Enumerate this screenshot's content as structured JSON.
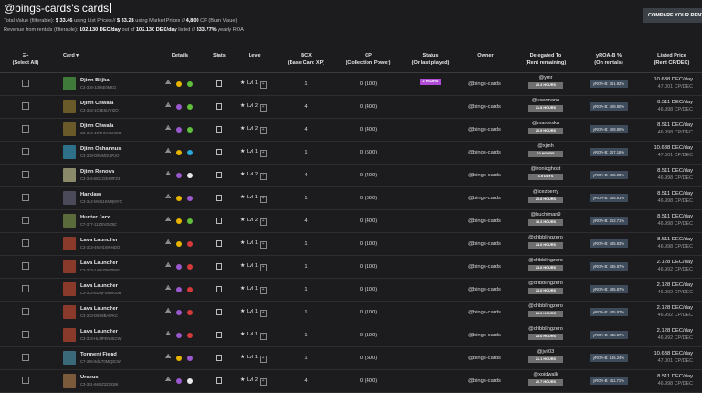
{
  "title": "@bings-cards's cards",
  "summary": {
    "line1_a": "Total Value (filterable):",
    "list_value": "$ 33.46",
    "line1_b": "using List Prices //",
    "market_value": "$ 33.28",
    "line1_c": "using Market Prices //",
    "burn_value": "4,800",
    "line1_d": "CP (Burn Value)",
    "line2_a": "Revenue from rentals (filterable):",
    "revenue": "102.130 DEC/day",
    "line2_b": "out of",
    "revenue_total": "102.130 DEC/day",
    "line2_c": "listed //",
    "yearly_roa": "333.77%",
    "line2_d": "yearly ROA"
  },
  "compare_button": "COMPARE YOUR RENTAL",
  "headers": {
    "select_all": "Ξ+",
    "select_all_sub": "(Select All)",
    "card": "Card ▾",
    "details": "Details",
    "stats": "Stats",
    "level": "Level",
    "bcx": "BCX",
    "bcx_sub": "(Base Card XP)",
    "cp": "CP",
    "cp_sub": "(Collection Power)",
    "status": "Status",
    "status_sub": "(Or last played)",
    "owner": "Owner",
    "delegated": "Delegated To",
    "delegated_sub": "(Rent remaining)",
    "yroa": "yROA-B %",
    "yroa_sub": "(On rentals)",
    "listed": "Listed Price",
    "listed_sub": "(Rent CP/DEC)"
  },
  "colors": {
    "status_purple": "#b04bd6",
    "rent_gray": "#6f6f6f",
    "roa_blue": "#3e4b5a"
  },
  "rows": [
    {
      "name": "Djinn Biljka",
      "id": "C3-336-3J9SE0MKG",
      "level": "Lvl 1",
      "bcx": "1",
      "cp": "0 (100)",
      "status": "2 HOURS",
      "owner": "@bings-cards",
      "deleg_user": "@ymr",
      "deleg_rent": "20.3 HOURS",
      "yroa": "yROA-B: 361.92%",
      "price1": "10.638 DEC/day",
      "price2": "47.001 CP/DEC",
      "thumb": "#3f7a3a",
      "d1": "#e6b400",
      "d2": "#5fbf3a"
    },
    {
      "name": "Djinn Chwala",
      "id": "C3-348-1C9E6UYJZO",
      "level": "Lvl 2",
      "bcx": "4",
      "cp": "0 (400)",
      "status": "",
      "owner": "@bings-cards",
      "deleg_user": "@usermano",
      "deleg_rent": "21.8 HOURS",
      "yroa": "yROA-B: 408.80%",
      "price1": "8.511 DEC/day",
      "price2": "46.998 CP/DEC",
      "thumb": "#6a5a2a",
      "d1": "#9b59d0",
      "d2": "#5fbf3a"
    },
    {
      "name": "Djinn Chwala",
      "id": "C3-348-1STHXHMKGO",
      "level": "Lvl 2",
      "bcx": "4",
      "cp": "0 (400)",
      "status": "",
      "owner": "@bings-cards",
      "deleg_user": "@marceska",
      "deleg_rent": "20.9 HOURS",
      "yroa": "yROA-B: 408.80%",
      "price1": "8.511 DEC/day",
      "price2": "46.998 CP/DEC",
      "thumb": "#6a5a2a",
      "d1": "#9b59d0",
      "d2": "#5fbf3a"
    },
    {
      "name": "Djinn Oshannus",
      "id": "C3-339-D9UMGUPUO",
      "level": "Lvl 1",
      "bcx": "1",
      "cp": "0 (500)",
      "status": "",
      "owner": "@bings-cards",
      "deleg_user": "@xjmh",
      "deleg_rent": "22 HOURS",
      "yroa": "yROA-B: 267.16%",
      "price1": "10.638 DEC/day",
      "price2": "47.001 CP/DEC",
      "thumb": "#2e6f8a",
      "d1": "#e6b400",
      "d2": "#2aa8d8"
    },
    {
      "name": "Djinn Renova",
      "id": "C3-345-BGZO3HMFZ4",
      "level": "Lvl 2",
      "bcx": "4",
      "cp": "0 (400)",
      "status": "",
      "owner": "@bings-cards",
      "deleg_user": "@ironicghost",
      "deleg_rent": "1.5 DAYS",
      "yroa": "yROA-B: 465.93%",
      "price1": "8.511 DEC/day",
      "price2": "46.998 CP/DEC",
      "thumb": "#8a8a6a",
      "d1": "#9b59d0",
      "d2": "#e8e8e8"
    },
    {
      "name": "Harklaw",
      "id": "C3-342-MVN1KMQMYO",
      "level": "Lvl 1",
      "bcx": "1",
      "cp": "0 (500)",
      "status": "",
      "owner": "@bings-cards",
      "deleg_user": "@icezberry",
      "deleg_rent": "20.8 HOURS",
      "yroa": "yROA-B: 365.61%",
      "price1": "8.511 DEC/day",
      "price2": "46.998 CP/DEC",
      "thumb": "#4a4a5a",
      "d1": "#e6b400",
      "d2": "#9b59d0"
    },
    {
      "name": "Hunter Jarx",
      "id": "C7-377-11Z8IVDG9C",
      "level": "Lvl 2",
      "bcx": "4",
      "cp": "0 (400)",
      "status": "",
      "owner": "@bings-cards",
      "deleg_user": "@huchiman9",
      "deleg_rent": "18.3 HOURS",
      "yroa": "yROA-B: 252.71%",
      "price1": "8.511 DEC/day",
      "price2": "46.998 CP/DEC",
      "thumb": "#5a6a3a",
      "d1": "#e6b400",
      "d2": "#5fbf3a"
    },
    {
      "name": "Lava Launcher",
      "id": "C3-333-4NIH1WHNDO",
      "level": "Lvl 1",
      "bcx": "1",
      "cp": "0 (100)",
      "status": "",
      "owner": "@bings-cards",
      "deleg_user": "@dribblingzero",
      "deleg_rent": "23.6 HOURS",
      "yroa": "yROA-B: 445.83%",
      "price1": "8.511 DEC/day",
      "price2": "46.998 CP/DEC",
      "thumb": "#8a3a2a",
      "d1": "#e6b400",
      "d2": "#d43a3a"
    },
    {
      "name": "Lava Launcher",
      "id": "C3-333-1A6U7WZE9G",
      "level": "Lvl 1",
      "bcx": "1",
      "cp": "0 (100)",
      "status": "",
      "owner": "@bings-cards",
      "deleg_user": "@dribblingzero",
      "deleg_rent": "23.6 HOURS",
      "yroa": "yROA-B: 445.87%",
      "price1": "2.128 DEC/day",
      "price2": "46.992 CP/DEC",
      "thumb": "#8a3a2a",
      "d1": "#9b59d0",
      "d2": "#d43a3a"
    },
    {
      "name": "Lava Launcher",
      "id": "C3-333-EDQFSMOG08",
      "level": "Lvl 1",
      "bcx": "1",
      "cp": "0 (100)",
      "status": "",
      "owner": "@bings-cards",
      "deleg_user": "@dribblingzero",
      "deleg_rent": "23.6 HOURS",
      "yroa": "yROA-B: 445.87%",
      "price1": "2.128 DEC/day",
      "price2": "46.992 CP/DEC",
      "thumb": "#8a3a2a",
      "d1": "#9b59d0",
      "d2": "#d43a3a"
    },
    {
      "name": "Lava Launcher",
      "id": "C3-333-D6S8BAIPKC",
      "level": "Lvl 1",
      "bcx": "1",
      "cp": "0 (100)",
      "status": "",
      "owner": "@bings-cards",
      "deleg_user": "@dribblingzero",
      "deleg_rent": "23.6 HOURS",
      "yroa": "yROA-B: 445.87%",
      "price1": "2.128 DEC/day",
      "price2": "46.992 CP/DEC",
      "thumb": "#8a3a2a",
      "d1": "#9b59d0",
      "d2": "#d43a3a"
    },
    {
      "name": "Lava Launcher",
      "id": "C3-333-HLMFEN4SCW",
      "level": "Lvl 1",
      "bcx": "1",
      "cp": "0 (100)",
      "status": "",
      "owner": "@bings-cards",
      "deleg_user": "@dribblingzero",
      "deleg_rent": "23.6 HOURS",
      "yroa": "yROA-B: 445.87%",
      "price1": "2.128 DEC/day",
      "price2": "46.992 CP/DEC",
      "thumb": "#8a3a2a",
      "d1": "#9b59d0",
      "d2": "#d43a3a"
    },
    {
      "name": "Torment Fiend",
      "id": "C7-356-9dUT0MQ3CW",
      "level": "Lvl 1",
      "bcx": "1",
      "cp": "0 (500)",
      "status": "",
      "owner": "@bings-cards",
      "deleg_user": "@jvii03",
      "deleg_rent": "21.1 HOURS",
      "yroa": "yROA-B: 185.24%",
      "price1": "10.638 DEC/day",
      "price2": "47.001 CP/DEC",
      "thumb": "#3a6a7a",
      "d1": "#e6b400",
      "d2": "#9b59d0"
    },
    {
      "name": "Uraeus",
      "id": "C3-351-66I0Z2Z2CBK",
      "level": "Lvl 2",
      "bcx": "4",
      "cp": "0 (400)",
      "status": "",
      "owner": "@bings-cards",
      "deleg_user": "@xoidwalk",
      "deleg_rent": "20.7 HOURS",
      "yroa": "yROA-B: 411.71%",
      "price1": "8.511 DEC/day",
      "price2": "46.998 CP/DEC",
      "thumb": "#7a5a3a",
      "d1": "#9b59d0",
      "d2": "#e8e8e8"
    }
  ]
}
